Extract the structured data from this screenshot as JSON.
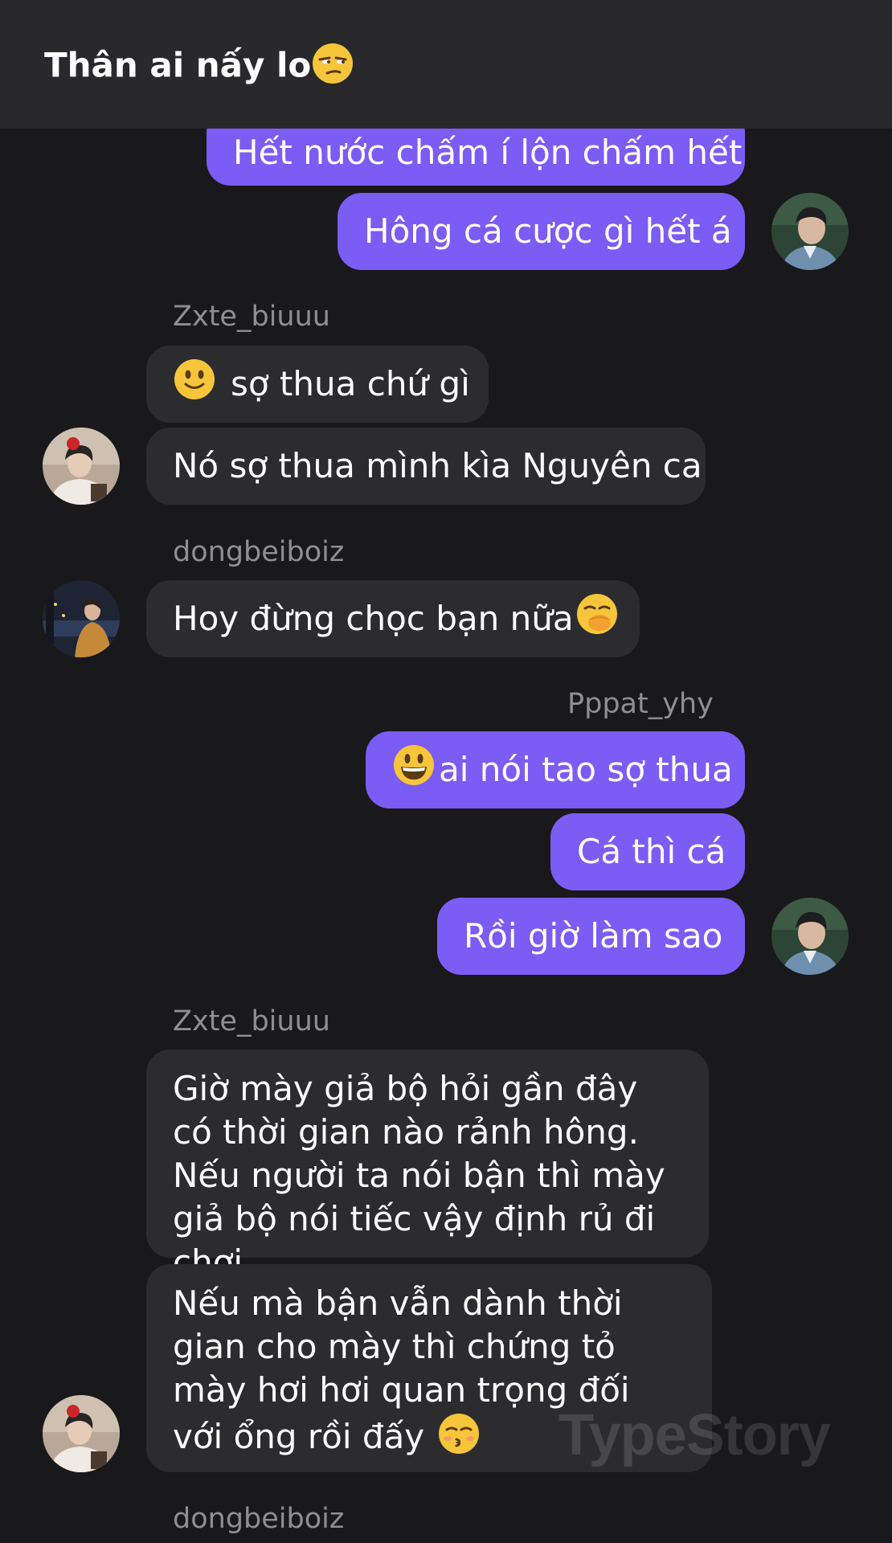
{
  "header": {
    "title": "Thân ai nấy lo",
    "title_emoji": "unamused-face-emoji"
  },
  "messages": [
    {
      "text": "Hết nước chấm í lộn chấm hết"
    },
    {
      "text": "Hông cá cược gì hết á"
    },
    {
      "sender": "Zxte_biuuu"
    },
    {
      "text": "sợ thua chứ gì",
      "emoji": "slightly-smiling-face-emoji"
    },
    {
      "text": "Nó sợ thua mình kìa Nguyên ca"
    },
    {
      "sender": "dongbeiboiz"
    },
    {
      "text": "Hoy đừng chọc bạn nữa",
      "emoji": "face-with-hand-over-mouth-emoji"
    },
    {
      "sender": "Pppat_yhy"
    },
    {
      "text": "ai nói tao sợ thua",
      "emoji": "grinning-face-emoji"
    },
    {
      "text": "Cá thì cá"
    },
    {
      "text": "Rồi giờ làm sao"
    },
    {
      "sender": "Zxte_biuuu"
    },
    {
      "text": "Giờ mày giả bộ hỏi gần đây có thời gian nào rảnh hông. Nếu người ta nói bận thì mày giả bộ nói tiếc vậy định rủ đi chơi"
    },
    {
      "text": "Nếu mà bận vẫn dành thời gian cho mày thì chứng tỏ mày hơi hơi quan trọng đối với ổng rồi đấy",
      "emoji": "kissing-face-emoji"
    },
    {
      "sender": "dongbeiboiz"
    }
  ],
  "watermark": "TypeStory",
  "colors": {
    "background": "#19191b",
    "header": "#29292b",
    "outgoing_bubble": "#7b5cf5",
    "incoming_bubble": "#2c2c2e",
    "sender_name": "#8e8e93"
  }
}
